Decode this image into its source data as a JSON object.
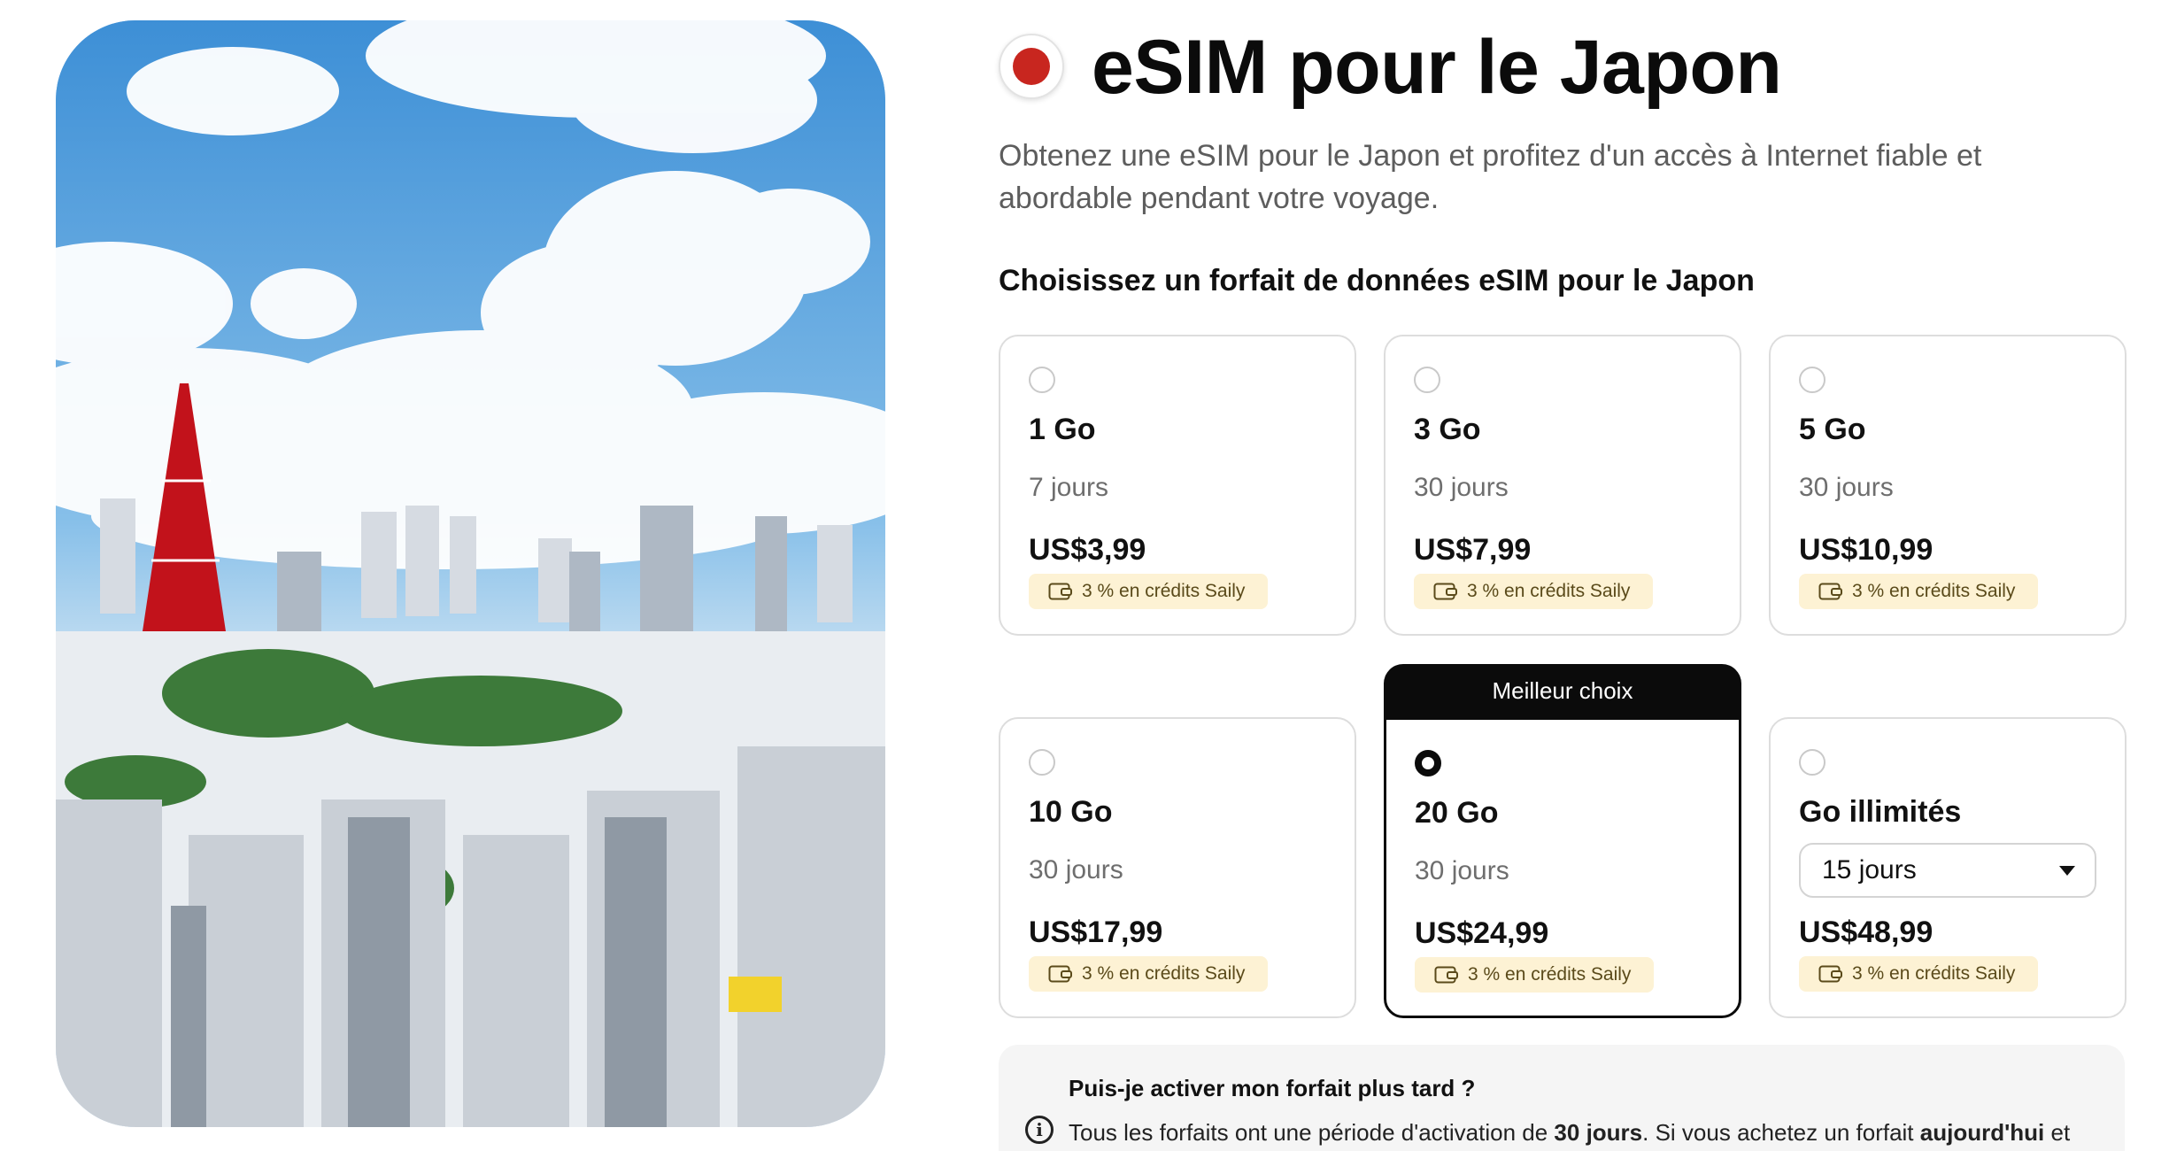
{
  "hero": {
    "image_icon": "tokyo-skyline-photo"
  },
  "header": {
    "flag_icon": "japan-flag-icon",
    "title": "eSIM pour le Japon",
    "subtitle": "Obtenez une eSIM pour le Japon et profitez d'un accès à Internet fiable et abordable pendant votre voyage."
  },
  "plans": {
    "section_title": "Choisissez un forfait de données eSIM pour le Japon",
    "best_badge": "Meilleur choix",
    "credit_icon": "wallet-icon",
    "items": [
      {
        "data": "1 Go",
        "days": "7 jours",
        "price": "US$3,99",
        "credit": "3 % en crédits Saily",
        "selected": false
      },
      {
        "data": "3 Go",
        "days": "30 jours",
        "price": "US$7,99",
        "credit": "3 % en crédits Saily",
        "selected": false
      },
      {
        "data": "5 Go",
        "days": "30 jours",
        "price": "US$10,99",
        "credit": "3 % en crédits Saily",
        "selected": false
      },
      {
        "data": "10 Go",
        "days": "30 jours",
        "price": "US$17,99",
        "credit": "3 % en crédits Saily",
        "selected": false
      },
      {
        "data": "20 Go",
        "days": "30 jours",
        "price": "US$24,99",
        "credit": "3 % en crédits Saily",
        "selected": true
      },
      {
        "data": "Go illimités",
        "days_select": "15 jours",
        "price": "US$48,99",
        "credit": "3 % en crédits Saily",
        "selected": false
      }
    ]
  },
  "faq": {
    "question": "Puis-je activer mon forfait plus tard ?",
    "answer_part1": "Tous les forfaits ont une période d'activation de ",
    "answer_bold1": "30 jours",
    "answer_part2": ". Si vous achetez un forfait ",
    "answer_bold2": "aujourd'hui",
    "answer_part3": " et",
    "info_icon": "info-icon"
  }
}
